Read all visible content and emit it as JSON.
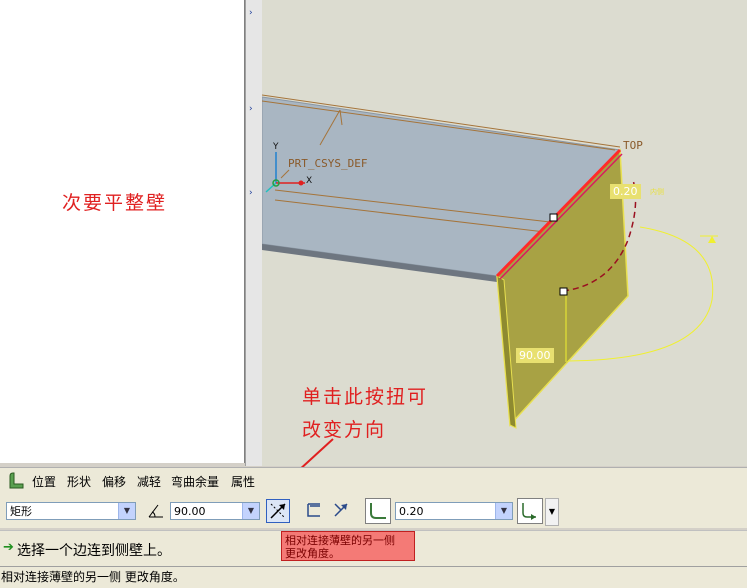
{
  "left_panel": {
    "annotation": "次要平整壁"
  },
  "viewport": {
    "csys_label": "PRT_CSYS_DEF",
    "axis_y": "Y",
    "axis_x": "X",
    "plane_label": "TOP",
    "thickness_value": "0.20",
    "thickness_suffix": "内侧",
    "angle_value": "90.00",
    "annotation_line1": "单击此按扭可",
    "annotation_line2": "改变方向"
  },
  "menubar": {
    "items": [
      "位置",
      "形状",
      "偏移",
      "减轻",
      "弯曲余量",
      "属性"
    ]
  },
  "toolbar": {
    "shape_value": "矩形",
    "angle_value": "90.00",
    "thickness_value": "0.20"
  },
  "message": {
    "text": "选择一个边连到侧壁上。"
  },
  "tooltip": {
    "line1": "相对连接薄壁的另一侧",
    "line2": "更改角度。"
  },
  "status": {
    "text": "相对连接薄壁的另一侧 更改角度。"
  },
  "colors": {
    "wall_fill": "#a8a244",
    "plate_fill": "#a9b6c2",
    "annotation_red": "#e02020",
    "highlight_edge": "#ff2a2a"
  }
}
